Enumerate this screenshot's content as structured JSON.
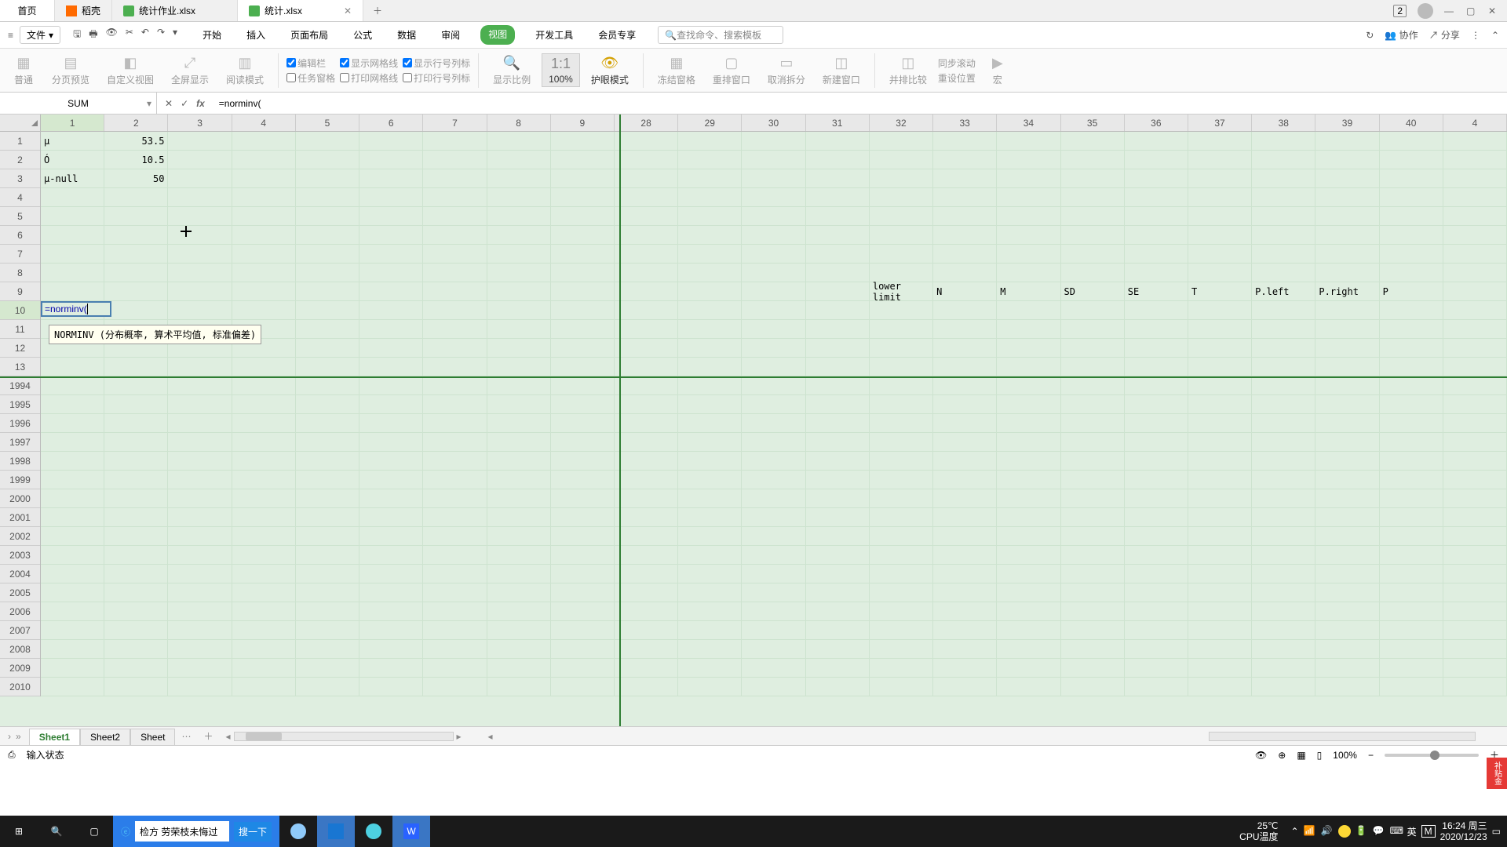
{
  "tabs": {
    "home": "首页",
    "docker": "稻壳",
    "file1": "统计作业.xlsx",
    "file2": "统计.xlsx"
  },
  "topright": {
    "badge": "2"
  },
  "menubar": {
    "file": "文件",
    "items": [
      "开始",
      "插入",
      "页面布局",
      "公式",
      "数据",
      "审阅",
      "视图",
      "开发工具",
      "会员专享"
    ],
    "active_index": 6,
    "search_ph": "查找命令、搜索模板",
    "collab": "协作",
    "share": "分享"
  },
  "ribbon": {
    "normal": "普通",
    "pagebreak": "分页预览",
    "custom": "自定义视图",
    "fullscreen": "全屏显示",
    "readmode": "阅读模式",
    "editbar": "编辑栏",
    "gridlines": "显示网格线",
    "rowcolnum": "显示行号列标",
    "taskpane": "任务窗格",
    "printgrid": "打印网格线",
    "printrowcol": "打印行号列标",
    "showratio": "显示比例",
    "pct100": "100%",
    "eyecare": "护眼模式",
    "freeze": "冻结窗格",
    "rearrange": "重排窗口",
    "unsplit": "取消拆分",
    "newwin": "新建窗口",
    "sidebyside": "并排比较",
    "syncscroll": "同步滚动",
    "resetpos": "重设位置",
    "macro": "宏"
  },
  "fbar": {
    "name": "SUM",
    "cancel": "✕",
    "confirm": "✓",
    "fx": "fx",
    "formula": "=norminv("
  },
  "cols_left": [
    "1",
    "2",
    "3",
    "4",
    "5",
    "6",
    "7",
    "8",
    "9"
  ],
  "cols_right": [
    "28",
    "29",
    "30",
    "31",
    "32",
    "33",
    "34",
    "35",
    "36",
    "37",
    "38",
    "39",
    "40",
    "4"
  ],
  "rows_top": [
    "1",
    "2",
    "3",
    "4",
    "5",
    "6",
    "7",
    "8",
    "9",
    "10",
    "11",
    "12",
    "13"
  ],
  "rows_bottom": [
    "1994",
    "1995",
    "1996",
    "1997",
    "1998",
    "1999",
    "2000",
    "2001",
    "2002",
    "2003",
    "2004",
    "2005",
    "2006",
    "2007",
    "2008",
    "2009",
    "2010"
  ],
  "data": {
    "a1": "μ",
    "b1": "53.5",
    "a2": "Ó",
    "b2": "10.5",
    "a3": "μ-null",
    "b3": "50",
    "editing": "=norminv(",
    "tooltip": "NORMINV (分布概率, 算术平均值, 标准偏差)",
    "hdr": {
      "lower": "lower limit",
      "n": "N",
      "m": "M",
      "sd": "SD",
      "se": "SE",
      "t": "T",
      "pleft": "P.left",
      "pright": "P.right",
      "p": "P"
    }
  },
  "sheets": {
    "s1": "Sheet1",
    "s2": "Sheet2",
    "s3": "Sheet"
  },
  "status": {
    "icon": "⎙",
    "text": "输入状态",
    "zoom": "100%"
  },
  "taskbar": {
    "search_val": "检方 劳荣枝未悔过",
    "search_btn": "搜一下",
    "temp": "25℃",
    "cpu": "CPU温度",
    "ime_lang": "英",
    "ime_m": "M",
    "time": "16:24 周三",
    "date": "2020/12/23"
  },
  "redtag": "补贴金"
}
